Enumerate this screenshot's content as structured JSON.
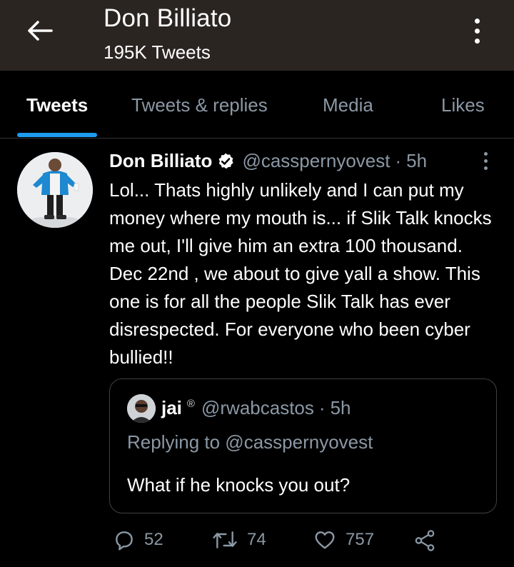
{
  "header": {
    "title": "Don Billiato",
    "subtitle": "195K Tweets"
  },
  "tabs": [
    {
      "label": "Tweets",
      "active": true
    },
    {
      "label": "Tweets & replies",
      "active": false
    },
    {
      "label": "Media",
      "active": false
    },
    {
      "label": "Likes",
      "active": false
    }
  ],
  "tweet": {
    "author_name": "Don Billiato",
    "handle": "@casspernyovest",
    "separator": "·",
    "time": "5h",
    "text": "Lol... Thats highly unlikely and I can put my money where my mouth is... if Slik Talk knocks me out, I'll give him an extra 100 thousand. Dec 22nd , we about to give yall a show. This one is for all the people Slik Talk has ever disrespected. For everyone who been cyber bullied!!",
    "quoted": {
      "author_name": "jai",
      "badge": "®",
      "handle": "@rwabcastos",
      "separator": "·",
      "time": "5h",
      "replying_to": "Replying to @casspernyovest",
      "text": "What if he knocks you out?"
    },
    "stats": {
      "replies": "52",
      "retweets": "74",
      "likes": "757"
    }
  },
  "colors": {
    "background": "#000000",
    "header_bg": "#2b2522",
    "accent": "#1d9bf0",
    "muted_text": "#8b98a5"
  },
  "icons": [
    "back-arrow-icon",
    "more-vertical-icon",
    "verified-badge-icon",
    "reply-icon",
    "retweet-icon",
    "like-icon",
    "share-icon"
  ]
}
